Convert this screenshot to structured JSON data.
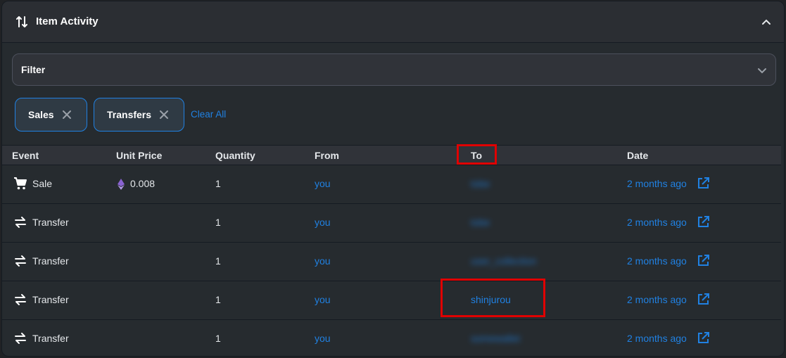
{
  "header": {
    "title": "Item Activity"
  },
  "filter": {
    "label": "Filter"
  },
  "chips": [
    {
      "label": "Sales"
    },
    {
      "label": "Transfers"
    }
  ],
  "clear_all": "Clear All",
  "table": {
    "headers": [
      "Event",
      "Unit Price",
      "Quantity",
      "From",
      "To",
      "Date"
    ],
    "rows": [
      {
        "event": "Sale",
        "icon": "cart-icon",
        "price": "0.008",
        "quantity": "1",
        "from": "you",
        "to": "tobe",
        "date": "2 months ago"
      },
      {
        "event": "Transfer",
        "icon": "transfer-icon",
        "price": "",
        "quantity": "1",
        "from": "you",
        "to": "tobe",
        "date": "2 months ago"
      },
      {
        "event": "Transfer",
        "icon": "transfer-icon",
        "price": "",
        "quantity": "1",
        "from": "you",
        "to": "user_collection",
        "date": "2 months ago"
      },
      {
        "event": "Transfer",
        "icon": "transfer-icon",
        "price": "",
        "quantity": "1",
        "from": "you",
        "to": "shinjurou",
        "date": "2 months ago"
      },
      {
        "event": "Transfer",
        "icon": "transfer-icon",
        "price": "",
        "quantity": "1",
        "from": "you",
        "to": "somewallet",
        "date": "2 months ago"
      }
    ]
  },
  "colors": {
    "accent": "#2081e2",
    "highlight": "#e00000",
    "background": "#262b2f"
  }
}
